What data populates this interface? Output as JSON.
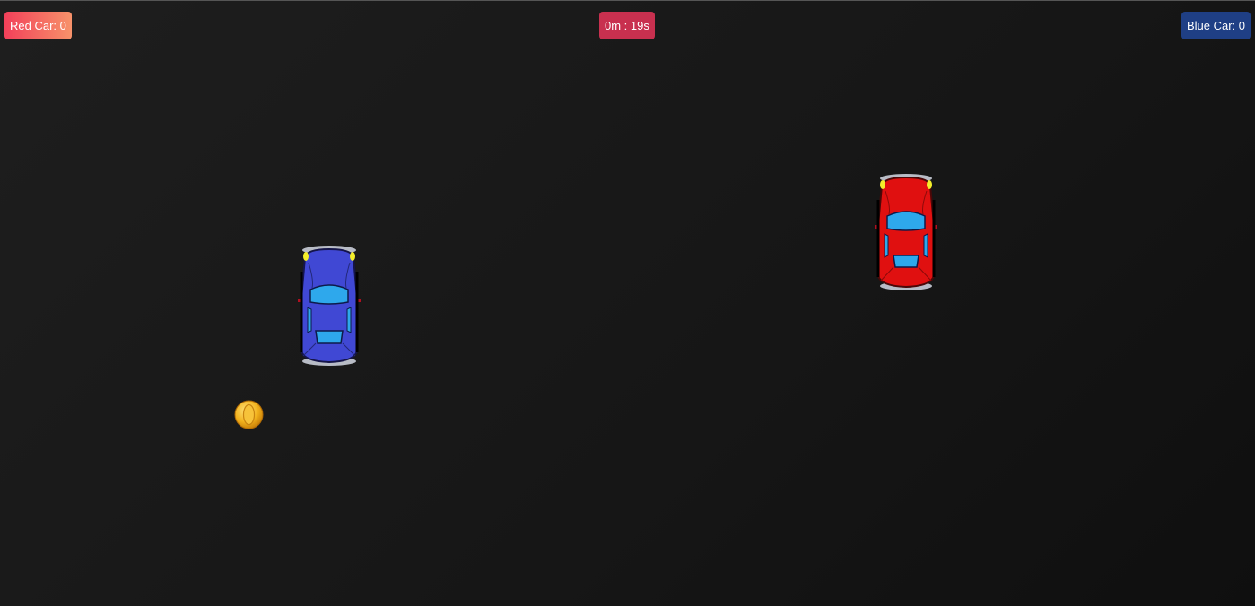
{
  "hud": {
    "red_score": "Red Car: 0",
    "timer": "0m : 19s",
    "blue_score": "Blue Car: 0"
  },
  "colors": {
    "background": "#1a1a1a",
    "red_badge_start": "#f2405a",
    "red_badge_end": "#f7926a",
    "timer_badge": "#c8304f",
    "blue_badge": "#1f3f85",
    "blue_car_body": "#4048d4",
    "red_car_body": "#e01010",
    "windows": "#2ea8ec",
    "coin": "#f2b21c"
  },
  "sprites": {
    "blue_car": "blue-car-icon",
    "red_car": "red-car-icon",
    "coin": "coin-icon"
  }
}
